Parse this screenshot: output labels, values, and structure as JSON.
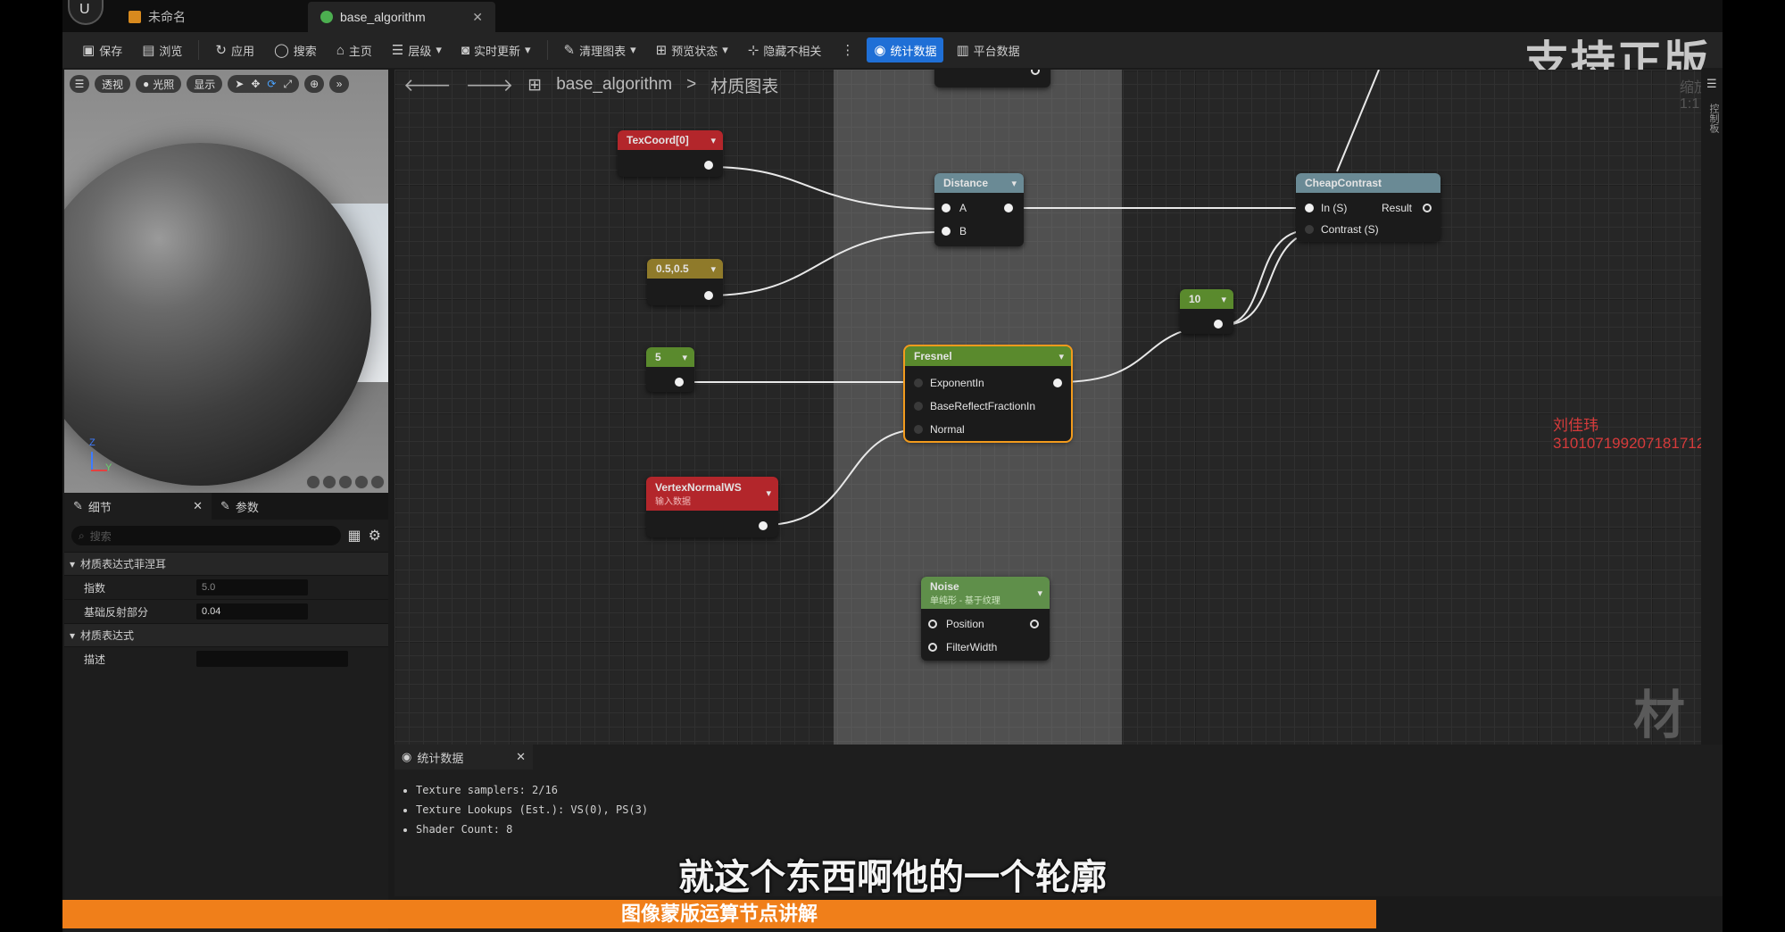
{
  "tabs": [
    {
      "label": "未命名"
    },
    {
      "label": "base_algorithm"
    }
  ],
  "toolbar": {
    "save": "保存",
    "browse": "浏览",
    "apply": "应用",
    "search": "搜索",
    "home": "主页",
    "hierarchy": "层级",
    "live_update": "实时更新",
    "clean_graph": "清理图表",
    "preview_state": "预览状态",
    "hide_unrelated": "隐藏不相关",
    "stats": "统计数据",
    "platform_stats": "平台数据"
  },
  "brand_watermark": "支持正版",
  "zoom": "缩放1:1",
  "viewport": {
    "perspective": "透视",
    "lit": "光照",
    "show": "显示",
    "axis_z": "Z",
    "axis_y": "Y"
  },
  "details": {
    "tab_details": "细节",
    "tab_params": "参数",
    "search_placeholder": "搜索",
    "category_fresnel": "材质表达式菲涅耳",
    "prop_exponent": "指数",
    "val_exponent": "5.0",
    "prop_base_reflect": "基础反射部分",
    "val_base_reflect": "0.04",
    "category_expression": "材质表达式",
    "prop_desc": "描述",
    "val_desc": ""
  },
  "graph": {
    "breadcrumb_root": "base_algorithm",
    "breadcrumb_sep": ">",
    "breadcrumb_leaf": "材质图表",
    "nodes": {
      "texcoord": "TexCoord[0]",
      "const2": "0.5,0.5",
      "const5": "5",
      "vertex_normal": "VertexNormalWS",
      "vertex_normal_sub": "输入数据",
      "distance": "Distance",
      "distance_a": "A",
      "distance_b": "B",
      "fresnel": "Fresnel",
      "fresnel_exp": "ExponentIn",
      "fresnel_base": "BaseReflectFractionIn",
      "fresnel_normal": "Normal",
      "noise": "Noise",
      "noise_sub": "单纯形 - 基于纹理",
      "noise_pos": "Position",
      "noise_fw": "FilterWidth",
      "const10": "10",
      "cheap": "CheapContrast",
      "cheap_in": "In (S)",
      "cheap_result": "Result",
      "cheap_contrast": "Contrast (S)"
    }
  },
  "right_strip": "控制板",
  "stats": {
    "tab": "统计数据",
    "lines": [
      "Texture samplers: 2/16",
      "Texture Lookups (Est.): VS(0), PS(3)",
      "Shader Count: 8"
    ]
  },
  "red_id": "刘佳玮310107199207181712",
  "material_watermark": "材质",
  "subtitle": "就这个东西啊他的一个轮廓",
  "banner": "图像蒙版运算节点讲解",
  "colors": {
    "accent_blue": "#1f6fd6",
    "selected_orange": "#f29b1d",
    "banner_orange": "#f07f1a",
    "red_header": "#b3262b",
    "olive_header": "#8f7a2a",
    "green_header": "#5a8a2d",
    "gray_header": "#6a8a95"
  }
}
